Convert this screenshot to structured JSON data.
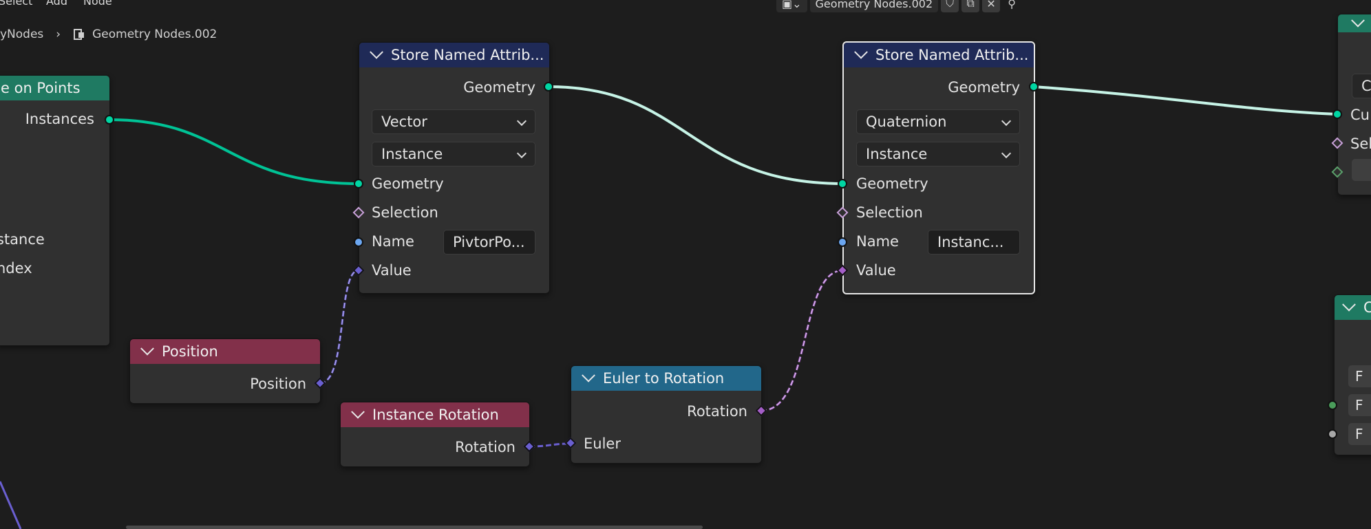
{
  "menu": {
    "select": "Select",
    "add": "Add",
    "node": "Node"
  },
  "breadcrumb": {
    "parent": "yNodes",
    "current": "Geometry Nodes.002"
  },
  "header": {
    "tree_name": "Geometry Nodes.002"
  },
  "nodes": {
    "instance_on_points": {
      "title": "e on Points",
      "outputs": [
        "Instances",
        "stance",
        "ndex"
      ]
    },
    "store_vector": {
      "title": "Store Named Attrib...",
      "output": "Geometry",
      "data_type": "Vector",
      "domain": "Instance",
      "inputs": {
        "geometry": "Geometry",
        "selection": "Selection",
        "name": "Name",
        "value": "Value"
      },
      "name_value": "PivtorPo..."
    },
    "store_quaternion": {
      "title": "Store Named Attrib...",
      "output": "Geometry",
      "data_type": "Quaternion",
      "domain": "Instance",
      "inputs": {
        "geometry": "Geometry",
        "selection": "Selection",
        "name": "Name",
        "value": "Value"
      },
      "name_value": "Instanc..."
    },
    "position": {
      "title": "Position",
      "output": "Position"
    },
    "instance_rotation": {
      "title": "Instance Rotation",
      "output": "Rotation"
    },
    "euler_to_rotation": {
      "title": "Euler to Rotation",
      "output": "Rotation",
      "input": "Euler"
    },
    "right_top": {
      "field_value": "C",
      "input_cu": "Cu",
      "input_sel": "Sel"
    },
    "right_bottom": {
      "title": "C",
      "btn1": "F",
      "btn2": "F",
      "btn3": "F"
    }
  },
  "colors": {
    "geometry_socket": "#00d6a3",
    "vector_socket": "#6a5fd0",
    "rotation_socket": "#a45ec8",
    "string_socket": "#6ba6f0",
    "header_attribute": "#1f2a57",
    "header_input": "#82304a",
    "header_converter": "#22678a",
    "header_instance": "#1f7a62"
  }
}
